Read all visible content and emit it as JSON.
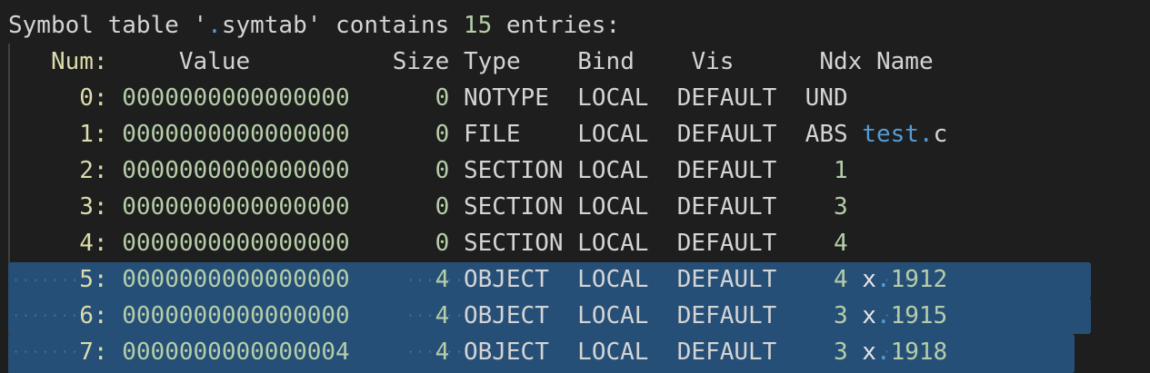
{
  "header": {
    "prefix": "Symbol table '",
    "dot": ".",
    "section": "symtab",
    "middle": "' contains ",
    "count": "15",
    "suffix": " entries:"
  },
  "columns": {
    "num": "Num:",
    "value": "Value",
    "size": "Size",
    "type": "Type",
    "bind": "Bind",
    "vis": "Vis",
    "ndx": "Ndx",
    "name": "Name"
  },
  "rows": [
    {
      "num": "0:",
      "value": "0000000000000000",
      "size": "0",
      "type": "NOTYPE",
      "bind": "LOCAL",
      "vis": "DEFAULT",
      "ndx": "UND",
      "name_a": "",
      "name_dot": "",
      "name_b": ""
    },
    {
      "num": "1:",
      "value": "0000000000000000",
      "size": "0",
      "type": "FILE",
      "bind": "LOCAL",
      "vis": "DEFAULT",
      "ndx": "ABS",
      "name_a": "test",
      "name_dot": ".",
      "name_b": "c"
    },
    {
      "num": "2:",
      "value": "0000000000000000",
      "size": "0",
      "type": "SECTION",
      "bind": "LOCAL",
      "vis": "DEFAULT",
      "ndx": "1",
      "name_a": "",
      "name_dot": "",
      "name_b": ""
    },
    {
      "num": "3:",
      "value": "0000000000000000",
      "size": "0",
      "type": "SECTION",
      "bind": "LOCAL",
      "vis": "DEFAULT",
      "ndx": "3",
      "name_a": "",
      "name_dot": "",
      "name_b": ""
    },
    {
      "num": "4:",
      "value": "0000000000000000",
      "size": "0",
      "type": "SECTION",
      "bind": "LOCAL",
      "vis": "DEFAULT",
      "ndx": "4",
      "name_a": "",
      "name_dot": "",
      "name_b": ""
    },
    {
      "num": "5:",
      "value": "0000000000000000",
      "size": "4",
      "type": "OBJECT",
      "bind": "LOCAL",
      "vis": "DEFAULT",
      "ndx": "4",
      "name_a": "x",
      "name_dot": ".",
      "name_b": "1912"
    },
    {
      "num": "6:",
      "value": "0000000000000000",
      "size": "4",
      "type": "OBJECT",
      "bind": "LOCAL",
      "vis": "DEFAULT",
      "ndx": "3",
      "name_a": "x",
      "name_dot": ".",
      "name_b": "1915"
    },
    {
      "num": "7:",
      "value": "0000000000000004",
      "size": "4",
      "type": "OBJECT",
      "bind": "LOCAL",
      "vis": "DEFAULT",
      "ndx": "3",
      "name_a": "x",
      "name_dot": ".",
      "name_b": "1918"
    }
  ],
  "colors": {
    "background": "#1e1e1e",
    "selection": "#264f78",
    "number": "#b5cea8",
    "text": "#d4d4d4",
    "accent": "#569cd6"
  }
}
